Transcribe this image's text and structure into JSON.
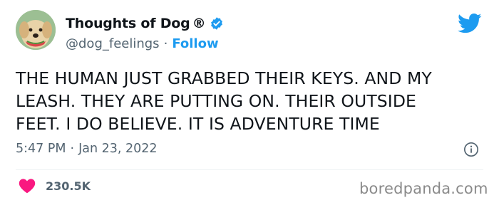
{
  "author": {
    "display_name": "Thoughts of Dog",
    "registered_mark": "®",
    "handle": "@dog_feelings",
    "separator": "·",
    "follow_label": "Follow",
    "verified": true
  },
  "tweet": {
    "text": "THE HUMAN JUST GRABBED THEIR KEYS. AND MY\nLEASH. THEY ARE PUTTING ON. THEIR OUTSIDE\nFEET. I DO BELIEVE. IT IS ADVENTURE TIME",
    "time": "5:47 PM",
    "separator": "·",
    "date": "Jan 23, 2022"
  },
  "engagement": {
    "likes": "230.5K"
  },
  "watermark": "boredpanda.com",
  "icons": {
    "verified": "verified-badge-icon",
    "brand": "twitter-bird-icon",
    "info": "info-icon",
    "like": "heart-icon"
  },
  "colors": {
    "accent": "#1d9bf0",
    "text": "#0f1419",
    "secondary": "#536471",
    "heart": "#f91880"
  }
}
